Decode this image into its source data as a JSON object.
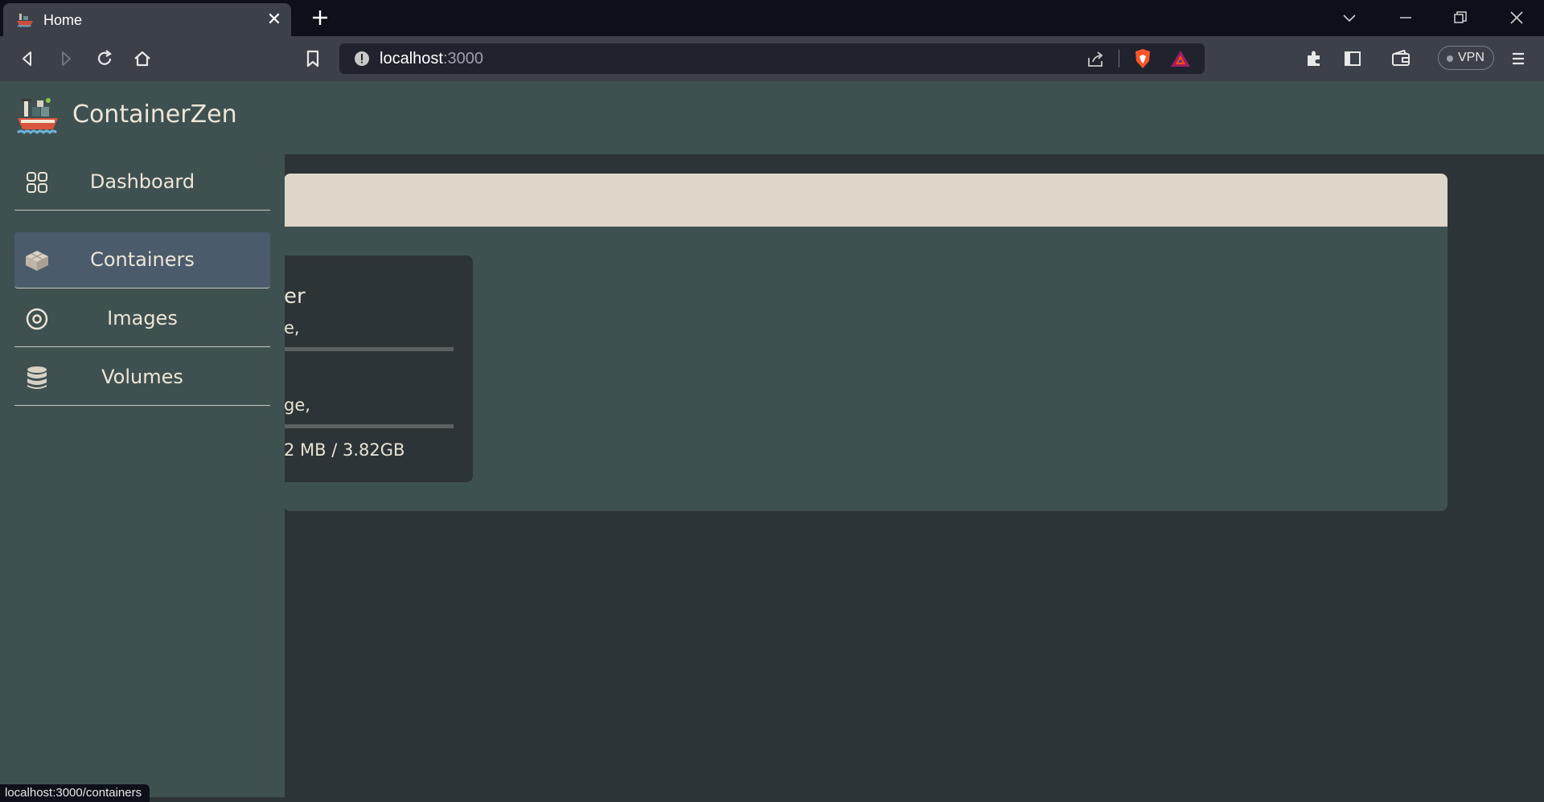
{
  "browser": {
    "tab": {
      "title": "Home"
    },
    "url": {
      "host": "localhost",
      "port": ":3000"
    },
    "vpn_label": "VPN",
    "status_link": "localhost:3000/containers"
  },
  "app": {
    "title": "ContainerZen",
    "nav": [
      {
        "label": "Dashboard",
        "icon": "grid-icon",
        "active": false
      },
      {
        "label": "Containers",
        "icon": "cube-icon",
        "active": true
      },
      {
        "label": "Images",
        "icon": "disc-icon",
        "active": false
      },
      {
        "label": "Volumes",
        "icon": "database-icon",
        "active": false
      }
    ],
    "card": {
      "title": "er",
      "line1": "e,",
      "line2": "ge,",
      "memory": "2 MB / 3.82GB"
    }
  },
  "colors": {
    "header_bg": "#3f5050",
    "content_bg": "#2d3437",
    "accent_bar": "#ddd7ca",
    "active_nav": "#4b5b6b"
  }
}
